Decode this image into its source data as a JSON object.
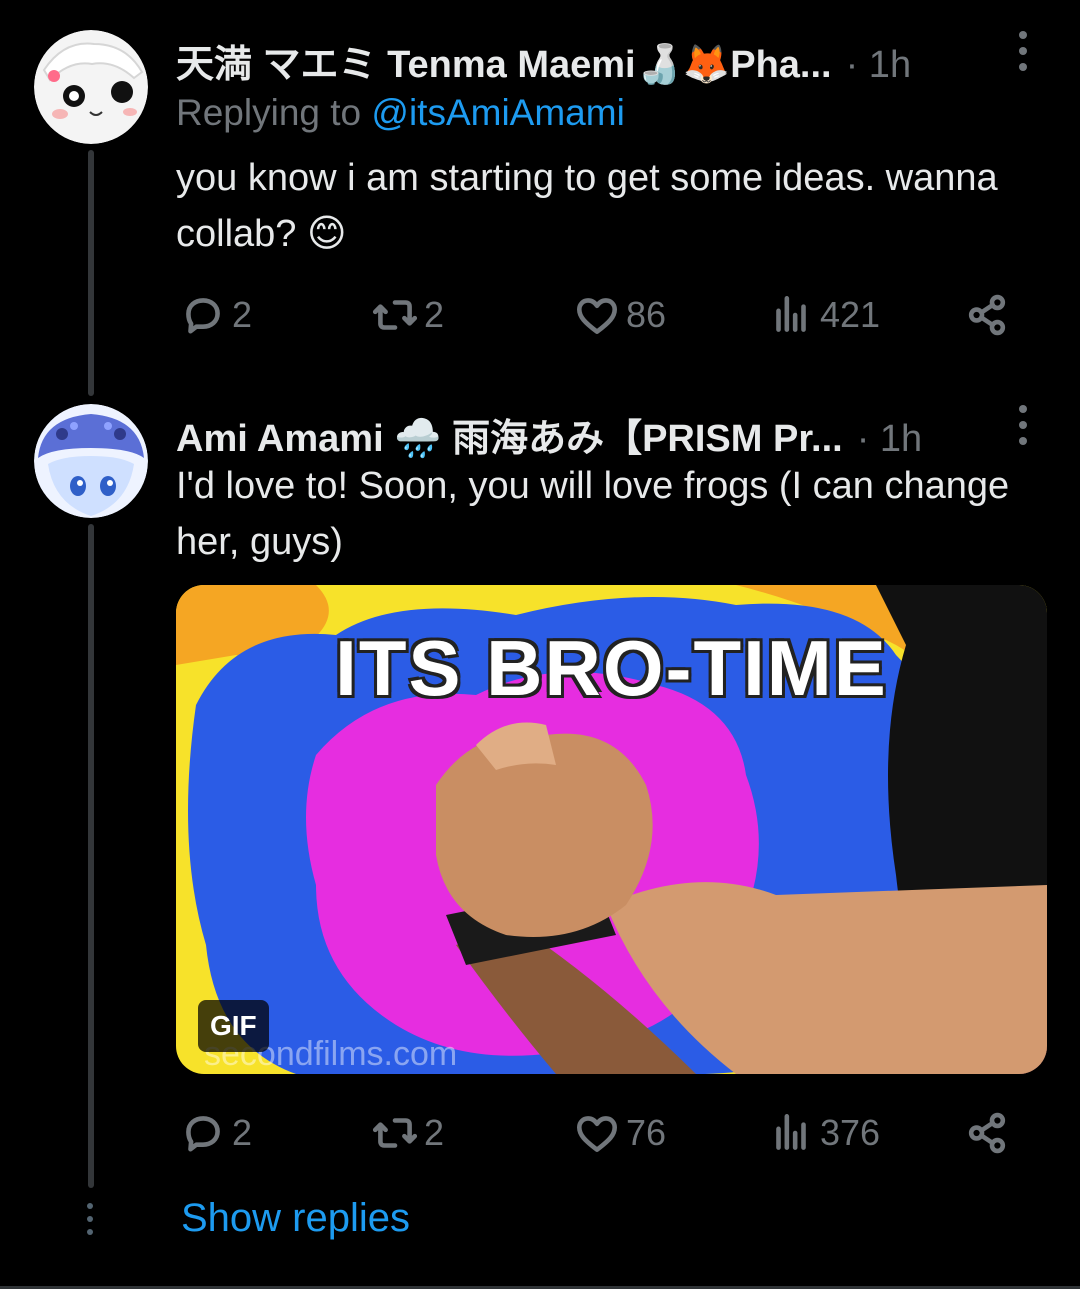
{
  "tweets": [
    {
      "author_name": "天満 マエミ Tenma Maemi🍶🦊Pha...",
      "time": "· 1h",
      "reply_prefix": "Replying to ",
      "reply_handle": "@itsAmiAmami",
      "text": "you know i am starting to get some ideas. wanna collab? 😊",
      "stats": {
        "replies": "2",
        "retweets": "2",
        "likes": "86",
        "views": "421"
      }
    },
    {
      "author_name": "Ami Amami 🌧️ 雨海あみ【PRISM Pr...",
      "time": "· 1h",
      "text": "I'd love to! Soon, you will love frogs (I can change her, guys)",
      "media": {
        "caption": "ITS BRO-TIME",
        "badge": "GIF",
        "watermark": "secondfilms.com"
      },
      "stats": {
        "replies": "2",
        "retweets": "2",
        "likes": "76",
        "views": "376"
      }
    }
  ],
  "show_replies": "Show replies",
  "icons": {
    "reply": "reply-icon",
    "retweet": "retweet-icon",
    "like": "heart-icon",
    "views": "views-icon",
    "share": "share-icon",
    "more": "more-vertical-icon"
  },
  "colors": {
    "background": "#000000",
    "text": "#e7e9ea",
    "muted": "#71767b",
    "accent": "#1d9bf0"
  }
}
